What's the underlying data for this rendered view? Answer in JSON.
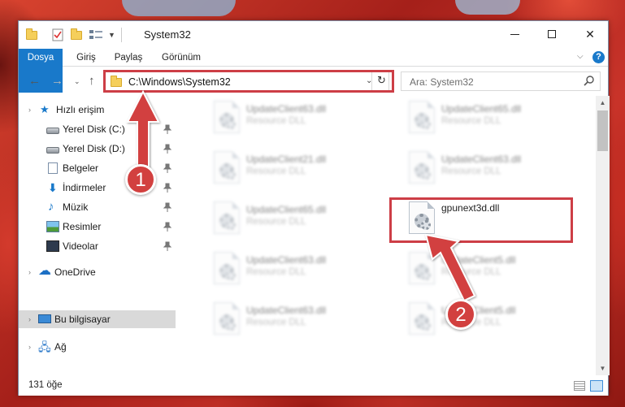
{
  "window": {
    "title": "System32",
    "controls": {
      "minimize": "minimize",
      "maximize": "maximize",
      "close": "✕"
    }
  },
  "ribbon": {
    "tabs": [
      {
        "label": "Dosya",
        "active": true
      },
      {
        "label": "Giriş"
      },
      {
        "label": "Paylaş"
      },
      {
        "label": "Görünüm"
      }
    ],
    "help": "?"
  },
  "nav": {
    "address": "C:\\Windows\\System32",
    "search_placeholder": "Ara: System32"
  },
  "sidebar": {
    "items": [
      {
        "label": "Hızlı erişim",
        "icon": "star-icon"
      },
      {
        "label": "Yerel Disk (C:)",
        "icon": "disk-icon",
        "pinned": true
      },
      {
        "label": "Yerel Disk (D:)",
        "icon": "disk-icon",
        "pinned": true
      },
      {
        "label": "Belgeler",
        "icon": "document-icon",
        "pinned": true
      },
      {
        "label": "İndirmeler",
        "icon": "download-icon",
        "pinned": true
      },
      {
        "label": "Müzik",
        "icon": "music-icon",
        "pinned": true
      },
      {
        "label": "Resimler",
        "icon": "pictures-icon",
        "pinned": true
      },
      {
        "label": "Videolar",
        "icon": "video-icon",
        "pinned": true
      },
      {
        "label": "OneDrive",
        "icon": "cloud-icon"
      },
      {
        "label": "Bu bilgisayar",
        "icon": "computer-icon",
        "selected": true
      },
      {
        "label": "Ağ",
        "icon": "network-icon"
      }
    ]
  },
  "files": [
    {
      "name": "UpdateClient63.dll",
      "desc": "Resource DLL",
      "blurred": true
    },
    {
      "name": "UpdateClient65.dll",
      "desc": "Resource DLL",
      "blurred": true
    },
    {
      "name": "UpdateClient21.dll",
      "desc": "Resource DLL",
      "blurred": true
    },
    {
      "name": "UpdateClient63.dll",
      "desc": "Resource DLL",
      "blurred": true
    },
    {
      "name": "UpdateClient65.dll",
      "desc": "Resource DLL",
      "blurred": true
    },
    {
      "name": "gpunext3d.dll",
      "desc": "",
      "blurred": false,
      "highlighted": true
    },
    {
      "name": "UpdateClient63.dll",
      "desc": "Resource DLL",
      "blurred": true
    },
    {
      "name": "UpdateClient5.dll",
      "desc": "Resource DLL",
      "blurred": true
    },
    {
      "name": "UpdateClient63.dll",
      "desc": "Resource DLL",
      "blurred": true
    },
    {
      "name": "UpdateClient5.dll",
      "desc": "Resource DLL",
      "blurred": true
    }
  ],
  "status": {
    "count": "131 öğe"
  },
  "annotations": {
    "step1": "1",
    "step2": "2",
    "accent": "#cd3e46"
  }
}
